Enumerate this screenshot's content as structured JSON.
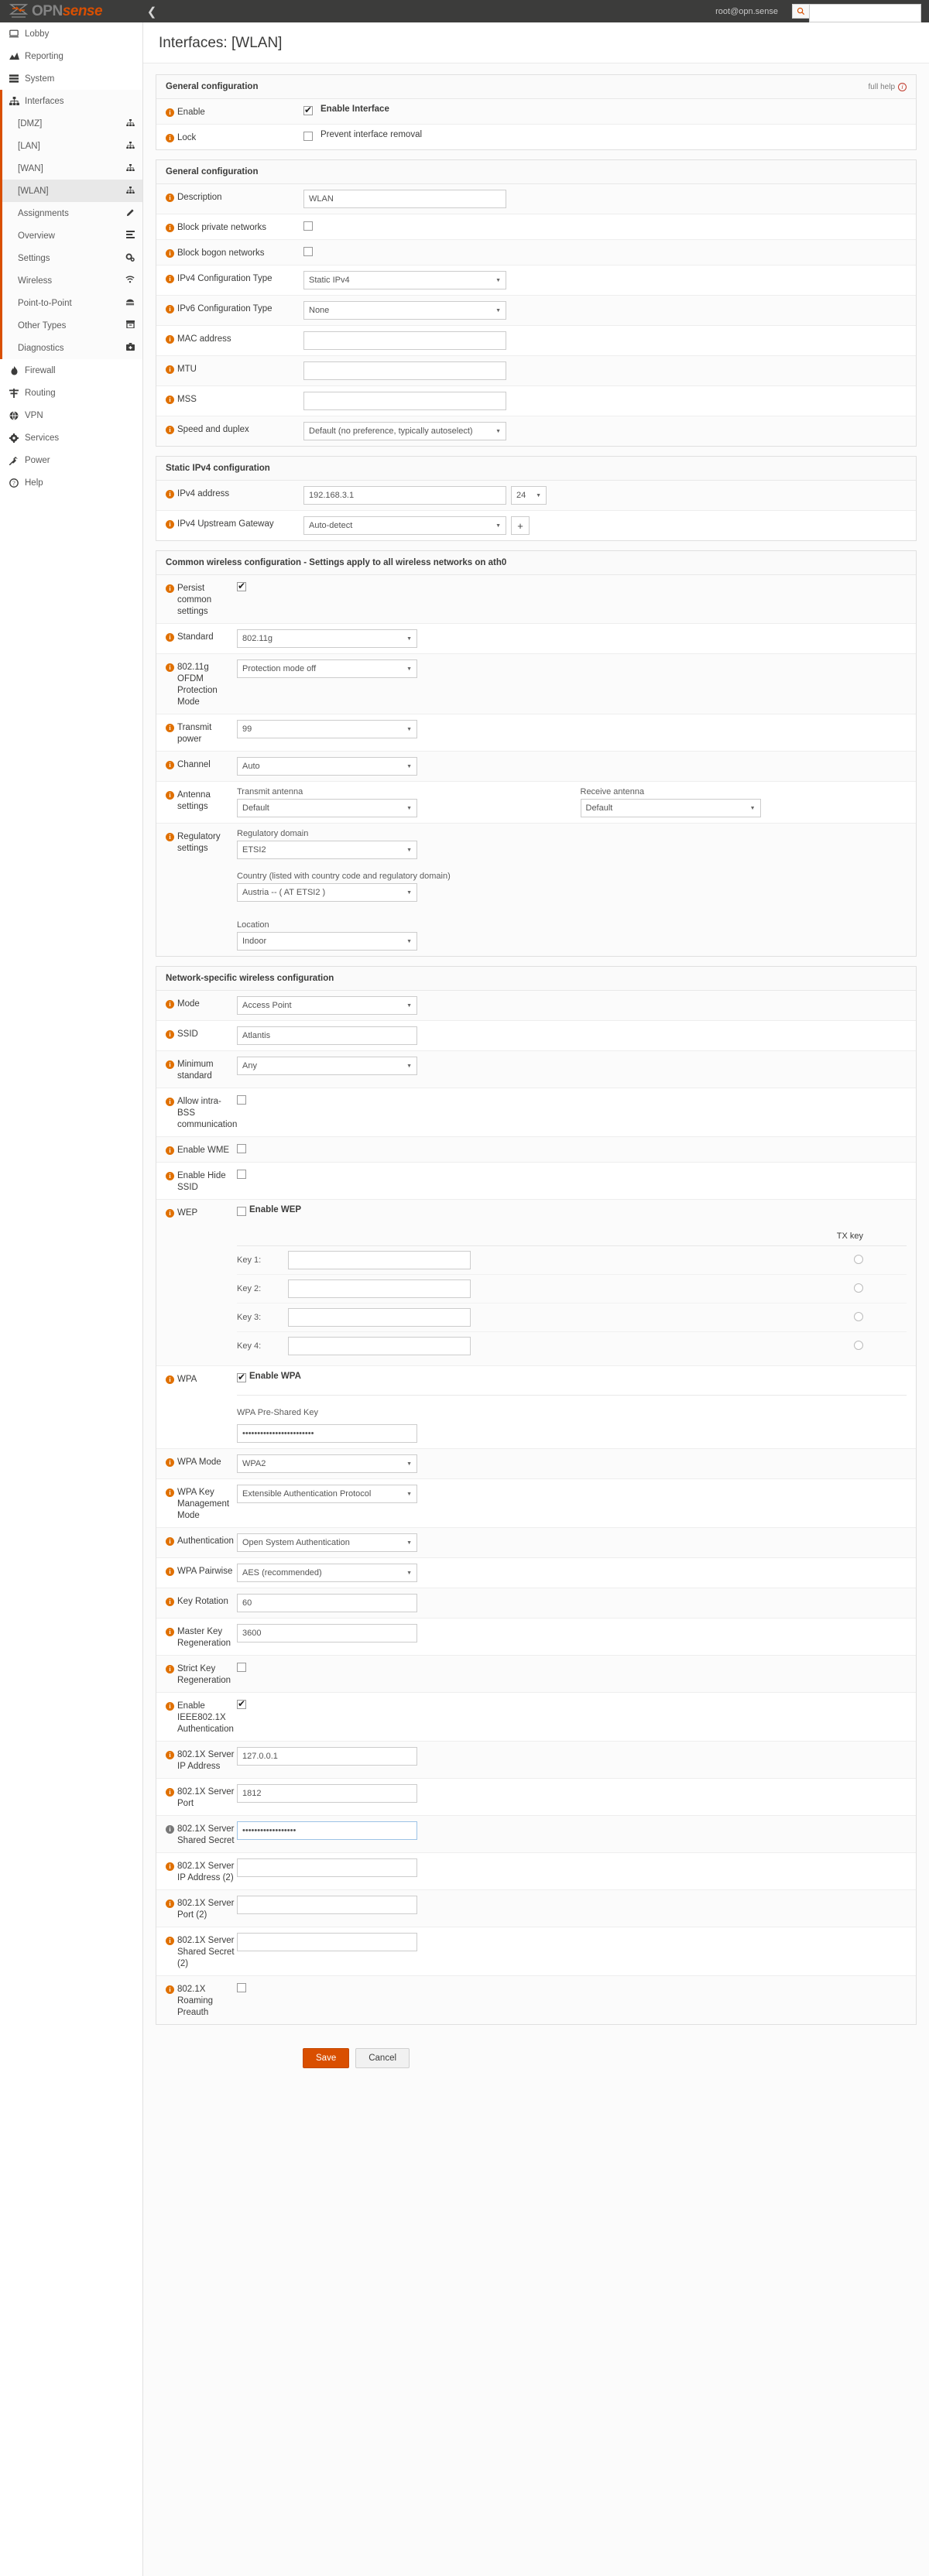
{
  "brand": {
    "opn": "OPN",
    "sense": "sense"
  },
  "topbar": {
    "user": "root@opn.sense",
    "search_placeholder": "",
    "search_value": "",
    "collapse_icon": "chevron-left"
  },
  "sidebar": {
    "items": [
      {
        "label": "Lobby",
        "icon": "lobby-icon"
      },
      {
        "label": "Reporting",
        "icon": "reporting-icon"
      },
      {
        "label": "System",
        "icon": "system-icon"
      },
      {
        "label": "Interfaces",
        "icon": "interfaces-icon"
      }
    ],
    "sub_items": [
      {
        "label": "[DMZ]",
        "icon": "network-icon"
      },
      {
        "label": "[LAN]",
        "icon": "network-icon"
      },
      {
        "label": "[WAN]",
        "icon": "network-icon"
      },
      {
        "label": "[WLAN]",
        "icon": "network-icon"
      },
      {
        "label": "Assignments",
        "icon": "pencil-icon"
      },
      {
        "label": "Overview",
        "icon": "list-icon"
      },
      {
        "label": "Settings",
        "icon": "gears-icon"
      },
      {
        "label": "Wireless",
        "icon": "wifi-icon"
      },
      {
        "label": "Point-to-Point",
        "icon": "modem-icon"
      },
      {
        "label": "Other Types",
        "icon": "archive-icon"
      },
      {
        "label": "Diagnostics",
        "icon": "medkit-icon"
      }
    ],
    "bottom_items": [
      {
        "label": "Firewall",
        "icon": "firewall-icon"
      },
      {
        "label": "Routing",
        "icon": "routing-icon"
      },
      {
        "label": "VPN",
        "icon": "vpn-icon"
      },
      {
        "label": "Services",
        "icon": "services-icon"
      },
      {
        "label": "Power",
        "icon": "power-icon"
      },
      {
        "label": "Help",
        "icon": "help-icon"
      }
    ]
  },
  "page": {
    "title": "Interfaces: [WLAN]"
  },
  "general1": {
    "heading": "General configuration",
    "full_help": "full help",
    "enable_label": "Enable",
    "enable_cb_label": "Enable Interface",
    "enable_checked": true,
    "lock_label": "Lock",
    "lock_cb_label": "Prevent interface removal",
    "lock_checked": false
  },
  "general2": {
    "heading": "General configuration",
    "description_label": "Description",
    "description_value": "WLAN",
    "block_private_label": "Block private networks",
    "block_private_checked": false,
    "block_bogon_label": "Block bogon networks",
    "block_bogon_checked": false,
    "ipv4_type_label": "IPv4 Configuration Type",
    "ipv4_type_value": "Static IPv4",
    "ipv6_type_label": "IPv6 Configuration Type",
    "ipv6_type_value": "None",
    "mac_label": "MAC address",
    "mac_value": "",
    "mtu_label": "MTU",
    "mtu_value": "",
    "mss_label": "MSS",
    "mss_value": "",
    "speed_label": "Speed and duplex",
    "speed_value": "Default (no preference, typically autoselect)"
  },
  "static_ipv4": {
    "heading": "Static IPv4 configuration",
    "address_label": "IPv4 address",
    "address_value": "192.168.3.1",
    "prefix_value": "24",
    "gateway_label": "IPv4 Upstream Gateway",
    "gateway_value": "Auto-detect",
    "add_gateway_icon": "plus-icon"
  },
  "common_wireless": {
    "heading": "Common wireless configuration - Settings apply to all wireless networks on ath0",
    "persist_label": "Persist common settings",
    "persist_checked": true,
    "standard_label": "Standard",
    "standard_value": "802.11g",
    "ofdm_label": "802.11g OFDM Protection Mode",
    "ofdm_value": "Protection mode off",
    "txpower_label": "Transmit power",
    "txpower_value": "99",
    "channel_label": "Channel",
    "channel_value": "Auto",
    "antenna_label": "Antenna settings",
    "tx_antenna_label": "Transmit antenna",
    "tx_antenna_value": "Default",
    "rx_antenna_label": "Receive antenna",
    "rx_antenna_value": "Default",
    "regulatory_label": "Regulatory settings",
    "reg_domain_label": "Regulatory domain",
    "reg_domain_value": "ETSI2",
    "country_label": "Country (listed with country code and regulatory domain)",
    "country_value": "Austria -- ( AT ETSI2 )",
    "location_label": "Location",
    "location_value": "Indoor"
  },
  "network_wireless": {
    "heading": "Network-specific wireless configuration",
    "mode_label": "Mode",
    "mode_value": "Access Point",
    "ssid_label": "SSID",
    "ssid_value": "Atlantis",
    "min_standard_label": "Minimum standard",
    "min_standard_value": "Any",
    "intra_bss_label": "Allow intra-BSS communication",
    "intra_bss_checked": false,
    "wme_label": "Enable WME",
    "wme_checked": false,
    "hide_ssid_label": "Enable Hide SSID",
    "hide_ssid_checked": false,
    "wep_label": "WEP",
    "wep_cb_label": "Enable WEP",
    "wep_checked": false,
    "tx_key_header": "TX key",
    "wep_keys": [
      {
        "label": "Key 1:",
        "value": "",
        "tx_selected": false
      },
      {
        "label": "Key 2:",
        "value": "",
        "tx_selected": false
      },
      {
        "label": "Key 3:",
        "value": "",
        "tx_selected": false
      },
      {
        "label": "Key 4:",
        "value": "",
        "tx_selected": false
      }
    ],
    "wpa_label": "WPA",
    "wpa_cb_label": "Enable WPA",
    "wpa_checked": true,
    "psk_label": "WPA Pre-Shared Key",
    "psk_value": "••••••••••••••••••••••••",
    "wpa_mode_label": "WPA Mode",
    "wpa_mode_value": "WPA2",
    "wpa_km_label": "WPA Key Management Mode",
    "wpa_km_value": "Extensible Authentication Protocol",
    "auth_label": "Authentication",
    "auth_value": "Open System Authentication",
    "pairwise_label": "WPA Pairwise",
    "pairwise_value": "AES (recommended)",
    "key_rotation_label": "Key Rotation",
    "key_rotation_value": "60",
    "master_key_label": "Master Key Regeneration",
    "master_key_value": "3600",
    "strict_key_label": "Strict Key Regeneration",
    "strict_key_checked": false,
    "ieee8021x_label": "Enable IEEE802.1X Authentication",
    "ieee8021x_checked": true,
    "srv_ip_label": "802.1X Server IP Address",
    "srv_ip_value": "127.0.0.1",
    "srv_port_label": "802.1X Server Port",
    "srv_port_value": "1812",
    "srv_secret_label": "802.1X Server Shared Secret",
    "srv_secret_value": "••••••••••••••••••",
    "srv_ip2_label": "802.1X Server IP Address (2)",
    "srv_ip2_value": "",
    "srv_port2_label": "802.1X Server Port (2)",
    "srv_port2_value": "",
    "srv_secret2_label": "802.1X Server Shared Secret (2)",
    "srv_secret2_value": "",
    "roaming_label": "802.1X Roaming Preauth",
    "roaming_checked": false
  },
  "actions": {
    "save_label": "Save",
    "cancel_label": "Cancel"
  },
  "colors": {
    "accent": "#d94f00",
    "info_badge": "#e07000",
    "topbar": "#3c3c3b"
  }
}
